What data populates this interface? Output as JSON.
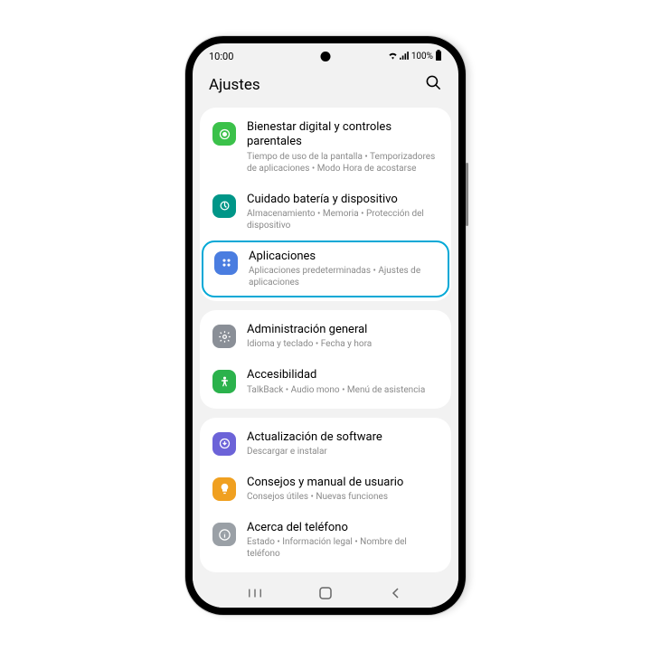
{
  "status": {
    "time": "10:00",
    "battery": "100%"
  },
  "header": {
    "title": "Ajustes"
  },
  "groups": [
    {
      "items": [
        {
          "title": "Bienestar digital y controles parentales",
          "sub": "Tiempo de uso de la pantalla • Temporizadores de aplicaciones • Modo Hora de acostarse",
          "icon": "wellbeing-icon",
          "cls": "ic-green1"
        },
        {
          "title": "Cuidado batería y dispositivo",
          "sub": "Almacenamiento • Memoria • Protección del dispositivo",
          "icon": "device-care-icon",
          "cls": "ic-teal"
        },
        {
          "title": "Aplicaciones",
          "sub": "Aplicaciones predeterminadas • Ajustes de aplicaciones",
          "icon": "apps-icon",
          "cls": "ic-blue",
          "highlight": true
        }
      ]
    },
    {
      "items": [
        {
          "title": "Administración general",
          "sub": "Idioma y teclado • Fecha y hora",
          "icon": "general-icon",
          "cls": "ic-grey"
        },
        {
          "title": "Accesibilidad",
          "sub": "TalkBack • Audio mono • Menú de asistencia",
          "icon": "accessibility-icon",
          "cls": "ic-green2"
        }
      ]
    },
    {
      "items": [
        {
          "title": "Actualización de software",
          "sub": "Descargar e instalar",
          "icon": "update-icon",
          "cls": "ic-purple"
        },
        {
          "title": "Consejos y manual de usuario",
          "sub": "Consejos útiles • Nuevas funciones",
          "icon": "tips-icon",
          "cls": "ic-orange"
        },
        {
          "title": "Acerca del teléfono",
          "sub": "Estado • Información legal • Nombre del teléfono",
          "icon": "about-icon",
          "cls": "ic-dark"
        }
      ]
    }
  ]
}
